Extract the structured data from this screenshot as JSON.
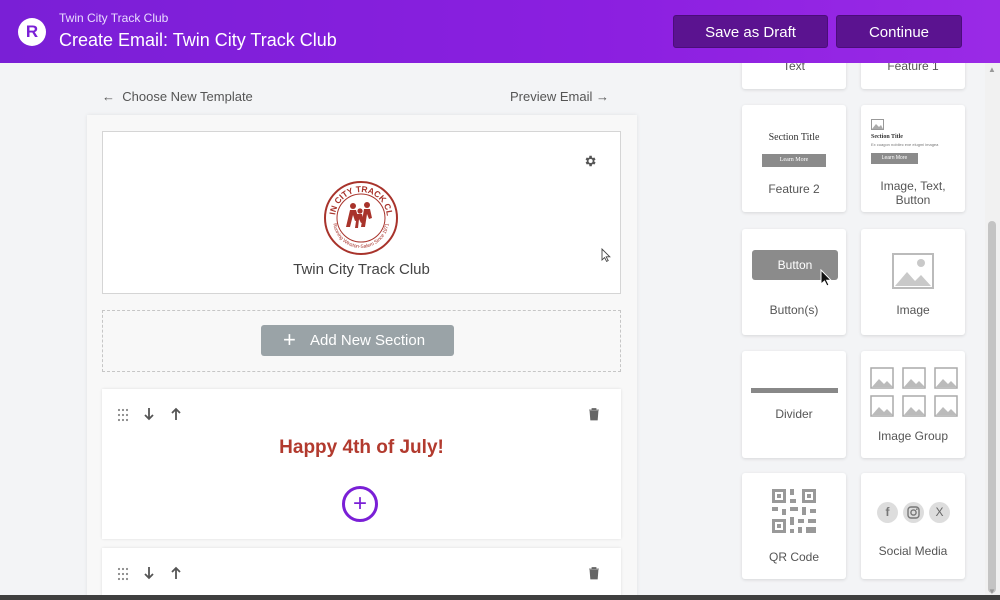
{
  "header": {
    "logo_letter": "R",
    "org_name": "Twin City Track Club",
    "title": "Create Email: Twin City Track Club",
    "save_draft_label": "Save as Draft",
    "continue_label": "Continue"
  },
  "editor": {
    "back_link": "Choose New Template",
    "preview_link": "Preview Email",
    "club_name": "Twin City Track Club",
    "logo_top_text": "TWIN CITY TRACK CLUB",
    "logo_bottom_text": "Running Winston-Salem Since 1971",
    "add_section_label": "Add New Section",
    "headline": "Happy 4th of July!"
  },
  "blocks": {
    "text": "Text",
    "feature1": "Feature 1",
    "feature2": "Feature 2",
    "feature2_preview_title": "Section Title",
    "feature2_preview_button": "Learn More",
    "image_text_button": "Image, Text, Button",
    "itb_preview_title": "Section Title",
    "itb_preview_sub": "Ex cuagon nobilec exe elugmi imagea",
    "itb_preview_button": "Learn More",
    "buttons": "Button(s)",
    "button_preview": "Button",
    "image": "Image",
    "divider": "Divider",
    "image_group": "Image Group",
    "qr_code": "QR Code",
    "social_media": "Social Media",
    "social_facebook": "f",
    "social_x": "X"
  },
  "colors": {
    "header_purple": "#7a1fd6",
    "headline_red": "#b23a2e",
    "add_button_gray": "#9aa3a7"
  }
}
